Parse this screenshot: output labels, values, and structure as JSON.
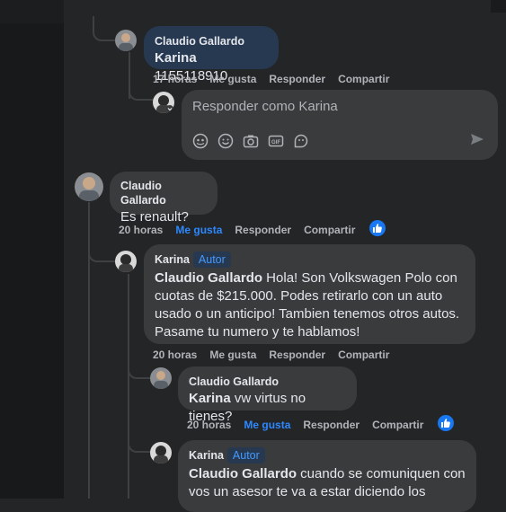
{
  "thread": {
    "comment1": {
      "author": "Claudio Gallardo",
      "mention": "Karina",
      "text": " 1155118910",
      "time": "17 horas",
      "like": "Me gusta",
      "reply": "Responder",
      "share": "Compartir"
    },
    "reply_input": {
      "placeholder": "Responder como Karina"
    },
    "comment2": {
      "author": "Claudio Gallardo",
      "text": "Es renault?",
      "time": "20 horas",
      "like": "Me gusta",
      "reply": "Responder",
      "share": "Compartir"
    },
    "comment3": {
      "author": "Karina",
      "badge": "Autor",
      "mention": "Claudio Gallardo",
      "text_line1": " Hola! Son Volkswagen Polo con",
      "text_line2": "cuotas de $215.000. Podes retirarlo con un auto",
      "text_line3": "usado o un anticipo! Tambien tenemos otros autos.",
      "text_line4": "Pasame tu numero y te hablamos!",
      "time": "20 horas",
      "like": "Me gusta",
      "reply": "Responder",
      "share": "Compartir"
    },
    "comment4": {
      "author": "Claudio Gallardo",
      "mention": "Karina",
      "text": " vw virtus no tienes?",
      "time": "20 horas",
      "like": "Me gusta",
      "reply": "Responder",
      "share": "Compartir"
    },
    "comment5": {
      "author": "Karina",
      "badge": "Autor",
      "mention": "Claudio Gallardo",
      "text_line1": " cuando se comuniquen con",
      "text_line2": "vos un asesor te va a estar diciendo los"
    }
  },
  "colors": {
    "background": "#242526",
    "bubble": "#3a3b3c",
    "highlight_bubble": "#263951",
    "accent": "#2d88ff"
  },
  "icons": [
    "avatar-icon",
    "emoji-icon",
    "camera-icon",
    "gif-icon",
    "sticker-icon",
    "send-icon",
    "like-icon"
  ]
}
